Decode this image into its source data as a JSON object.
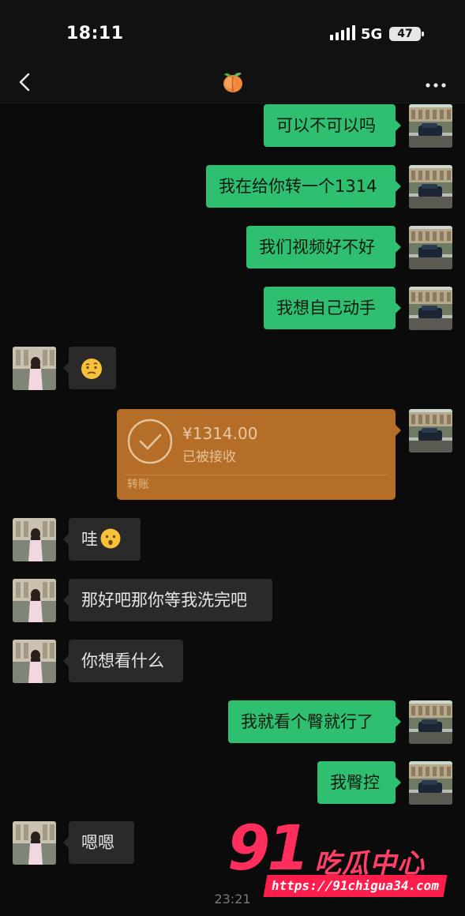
{
  "status_bar": {
    "time": "18:11",
    "network": "5G",
    "battery": "47"
  },
  "header": {
    "contact_icon": "peach-emoji",
    "back_icon": "chevron-left-icon",
    "more_icon": "more-dots-icon"
  },
  "messages": [
    {
      "side": "out",
      "text": "可以不可以吗"
    },
    {
      "side": "out",
      "text": "我在给你转一个1314"
    },
    {
      "side": "out",
      "text": "我们视频好不好"
    },
    {
      "side": "out",
      "text": "我想自己动手"
    },
    {
      "side": "in",
      "text": "",
      "emoji": "confused-face-emoji"
    },
    {
      "side": "out",
      "type": "transfer",
      "amount": "¥1314.00",
      "status": "已被接收",
      "label": "转账"
    },
    {
      "side": "in",
      "text": "哇",
      "emoji": "hushed-face-emoji"
    },
    {
      "side": "in",
      "text": "那好吧那你等我洗完吧"
    },
    {
      "side": "in",
      "text": "你想看什么"
    },
    {
      "side": "out",
      "text": "我就看个臀就行了"
    },
    {
      "side": "out",
      "text": "我臀控"
    },
    {
      "side": "in",
      "text": "嗯嗯"
    }
  ],
  "timestamp": "23:21",
  "watermark": {
    "number": "91",
    "name": "吃瓜中心",
    "url": "https://91chigua34.com"
  },
  "colors": {
    "outgoing_bubble": "#2fbf71",
    "incoming_bubble": "#2a2a2a",
    "transfer_card": "#b56e27",
    "background": "#0b0b0b",
    "watermark": "#ff2e5c"
  }
}
